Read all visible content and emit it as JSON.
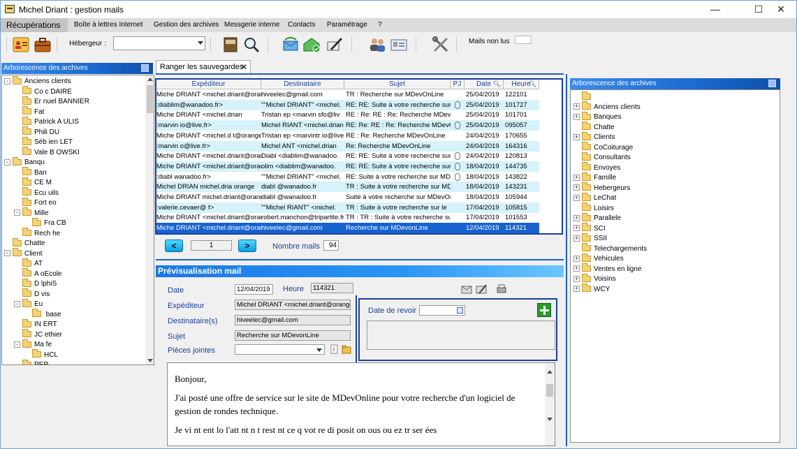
{
  "window": {
    "title": "Michel Driant : gestion mails"
  },
  "menu": [
    "Récupérations",
    "Boîte à lettres Internet",
    "Gestion des archives",
    "Messgerie interne",
    "Contacts",
    "Paramétrage",
    "?"
  ],
  "toolbar": {
    "hebergeur_label": "Hébergeur :",
    "hebergeur_value": "",
    "mails_non_lus_label": "Mails non lus",
    "mails_non_lus_value": ""
  },
  "left_panel": {
    "title": "Arborescence des archives",
    "items": [
      {
        "level": 0,
        "expander": "-",
        "label": "Anciens clients"
      },
      {
        "level": 1,
        "label": "Co  c DAIRE"
      },
      {
        "level": 1,
        "label": "Er   nuel BANNIER"
      },
      {
        "level": 1,
        "label": "Fat"
      },
      {
        "level": 1,
        "label": "Patrick A   ULIS"
      },
      {
        "level": 1,
        "label": "Phili   DU"
      },
      {
        "level": 1,
        "label": "Séb   ien  LET"
      },
      {
        "level": 1,
        "label": "Vale   B  OWSKI"
      },
      {
        "level": 0,
        "expander": "-",
        "label": "Banqu"
      },
      {
        "level": 1,
        "label": "Ban"
      },
      {
        "level": 1,
        "label": "CE   M"
      },
      {
        "level": 1,
        "label": "Ecu  uils"
      },
      {
        "level": 1,
        "label": "Fort   eo"
      },
      {
        "level": 1,
        "expander": "-",
        "label": "Mille"
      },
      {
        "level": 2,
        "label": "Fra   CB"
      },
      {
        "level": 1,
        "label": "Rech   he"
      },
      {
        "level": 0,
        "label": "Chatte"
      },
      {
        "level": 0,
        "expander": "-",
        "label": "Client"
      },
      {
        "level": 1,
        "label": "AT"
      },
      {
        "level": 1,
        "label": "A  oEcole"
      },
      {
        "level": 1,
        "label": "D  lphiS"
      },
      {
        "level": 1,
        "label": "D  vis"
      },
      {
        "level": 1,
        "expander": "-",
        "label": "Eu"
      },
      {
        "level": 2,
        "label": "  base"
      },
      {
        "level": 1,
        "label": "IN   ERT"
      },
      {
        "level": 1,
        "label": "JC   ethier"
      },
      {
        "level": 1,
        "expander": "-",
        "label": "Ma   fe"
      },
      {
        "level": 2,
        "label": "HCL"
      },
      {
        "level": 1,
        "label": "PER"
      }
    ]
  },
  "tab": {
    "label": "Ranger les sauvegardes"
  },
  "grid": {
    "columns": [
      "Expéditeur",
      "Destinataire",
      "Sujet",
      "PJ",
      "Date",
      "Heure"
    ],
    "rows": [
      {
        "expediteur": "Miche  DRIANT <michel.driant@orange",
        "destinataire": "hiveelec@gmail.com",
        "sujet": "TR : Recherche sur MDevOnLine",
        "pj": false,
        "date": "25/04/2019",
        "heure": "122101"
      },
      {
        "expediteur": ":diablim@wanadoo.fr>",
        "destinataire": "\"\"Michel  DRIANT\" <michel.",
        "sujet": "RE: RE: Suite à votre recherche sur MI",
        "pj": true,
        "date": "25/04/2019",
        "heure": "101727"
      },
      {
        "expediteur": "Miche  DRIANT <michel.drian",
        "destinataire": "Tristan  ep <marvin  sfo@liv",
        "sujet": "RE : Re: RE : Re: Recherche MDevOr",
        "pj": false,
        "date": "25/04/2019",
        "heure": "101701"
      },
      {
        "expediteur": ":marvin  io@live.fr>",
        "destinataire": "Michel  RIANT <michel.drian",
        "sujet": "RE: Re: RE : Re: Recherche MDevOnLine",
        "pj": true,
        "date": "25/04/2019",
        "heure": "095057"
      },
      {
        "expediteur": "Miche  DRIANT <michel.d  t@orange",
        "destinataire": "Tristan  ep <marvintr  io@live",
        "sujet": "RE : Re: Recherche MDevOnLine",
        "pj": false,
        "date": "24/04/2019",
        "heure": "170655"
      },
      {
        "expediteur": ":marvin  o@live.fr>",
        "destinataire": "Michel  ANT <michel.drian",
        "sujet": "Re: Recherche MDevOnLine",
        "pj": false,
        "date": "24/04/2019",
        "heure": "164316"
      },
      {
        "expediteur": "Miche  DRIANT <michel.driant@orange",
        "destinataire": "Diabl  <diablim@wanadoo.",
        "sujet": "RE: RE: Suite à votre recherche sur M",
        "pj": true,
        "date": "24/04/2019",
        "heure": "120813"
      },
      {
        "expediteur": "Miche  DRIANT <michel.driant@orange",
        "destinataire": "  olim <diablim@wanadoo.",
        "sujet": "RE: RE: Suite à votre recherche sur M",
        "pj": true,
        "date": "18/04/2019",
        "heure": "144735"
      },
      {
        "expediteur": ":diabl  wanadoo.fr>",
        "destinataire": "\"\"Michel  DRIANT\" <michel.",
        "sujet": "RE: Suite à votre recherche sur MDevc",
        "pj": true,
        "date": "18/04/2019",
        "heure": "143822"
      },
      {
        "expediteur": "Michel  DRIAN  michel.dria  orange",
        "destinataire": "diabl  @wanadoo.fr",
        "sujet": "TR : Suite à votre recherche sur MDev",
        "pj": false,
        "date": "18/04/2019",
        "heure": "143231"
      },
      {
        "expediteur": "Miche  DRIANT  michel.driant@orange",
        "destinataire": "diabl  @wanadoo.fr",
        "sujet": "Suite à votre recherche sur MDevOnLin",
        "pj": false,
        "date": "18/04/2019",
        "heure": "105944"
      },
      {
        "expediteur": ":valerie.cevaer@  f>",
        "destinataire": "\"\"Michel  RIANT\" <michel.",
        "sujet": "TR : Suite à votre recherche sur le",
        "pj": false,
        "date": "17/04/2019",
        "heure": "105815"
      },
      {
        "expediteur": "Miche  DRIANT <michel.driant@orange",
        "destinataire": "robert.manchon@tripartite.fr",
        "sujet": "TR : TR : Suite à votre recherche sur le",
        "pj": false,
        "date": "17/04/2019",
        "heure": "101553"
      },
      {
        "expediteur": "Miche  DRIANT <michel.driant@orange",
        "destinataire": "hiveelec@gmail.com",
        "sujet": "Recherche sur MDevonLine",
        "pj": false,
        "date": "12/04/2019",
        "heure": "114321"
      }
    ]
  },
  "pager": {
    "prev": "<",
    "page": "1",
    "next": ">",
    "nombre_label": "Nombre mails",
    "nombre_value": "94"
  },
  "preview": {
    "title": "Prévisualisation mail",
    "date_label": "Date",
    "date_value": "12/04/2019",
    "heure_label": "Heure",
    "heure_value": "114321",
    "expediteur_label": "Expéditeur",
    "expediteur_value": "Michel  DRIANT <michel.driant@orange.fr>",
    "destinataire_label": "Destinataire(s)",
    "destinataire_value": "hiveelec@gmail.com",
    "sujet_label": "Sujet",
    "sujet_value": "Recherche sur MDevonLine",
    "pj_label": "Pièces jointes",
    "pj_value": "",
    "revoir_label": "Date de revoir",
    "revoir_value": "",
    "body": [
      "Bonjour,",
      "J'ai posté une offre de service sur le site de MDevOnline pour votre recherche d'un logiciel de gestion de rondes technique.",
      "Je vi  nt   ent   lo  l'att  nt  n  t  rest  nt  ce q  vot  re di  posit  on  ous  ou  ez  tr  ser  ées"
    ]
  },
  "right_panel": {
    "title": "Arborescence des archives",
    "items": [
      {
        "expander": "",
        "label": ""
      },
      {
        "expander": "+",
        "label": "Anciens clients"
      },
      {
        "expander": "+",
        "label": "Banques"
      },
      {
        "expander": "",
        "label": "Chatte"
      },
      {
        "expander": "+",
        "label": "Clients"
      },
      {
        "expander": "",
        "label": "CoCoiturage"
      },
      {
        "expander": "",
        "label": "Consultants"
      },
      {
        "expander": "",
        "label": "Envoyes"
      },
      {
        "expander": "+",
        "label": "Famille"
      },
      {
        "expander": "+",
        "label": "Hebergeurs"
      },
      {
        "expander": "+",
        "label": "LeChat"
      },
      {
        "expander": "",
        "label": "Loisirs"
      },
      {
        "expander": "+",
        "label": "Parallele"
      },
      {
        "expander": "+",
        "label": "SCI"
      },
      {
        "expander": "+",
        "label": "SSII"
      },
      {
        "expander": "",
        "label": "Telechargements"
      },
      {
        "expander": "+",
        "label": "Vehicules"
      },
      {
        "expander": "+",
        "label": "Ventes en ligne"
      },
      {
        "expander": "+",
        "label": "Voisins"
      },
      {
        "expander": "+",
        "label": "WCY"
      }
    ]
  }
}
